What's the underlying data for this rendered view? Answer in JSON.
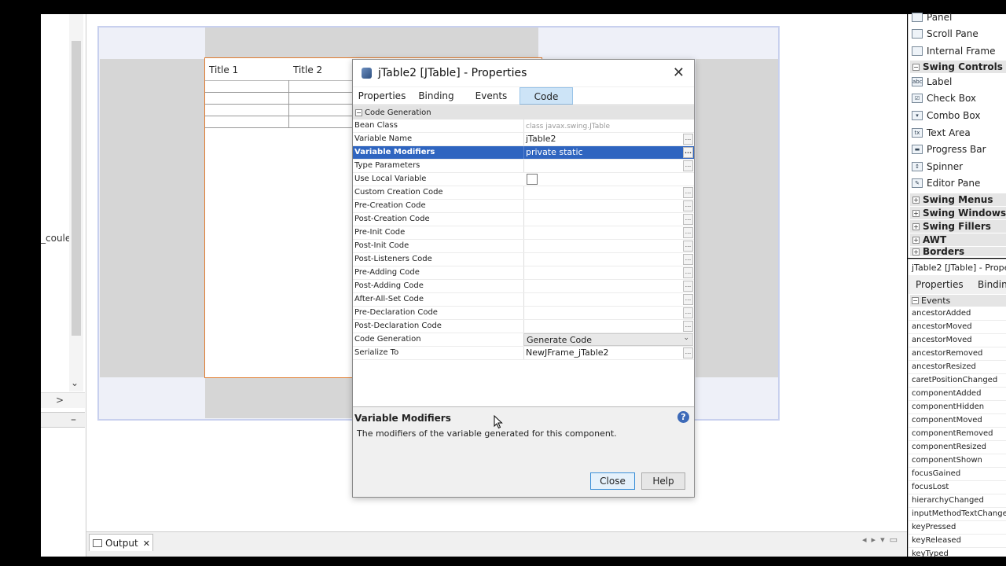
{
  "left_panel": {
    "label": "_couleu"
  },
  "canvas": {
    "table": {
      "col1": "Title 1",
      "col2": "Title 2"
    }
  },
  "output": {
    "tab_label": "Output",
    "close": "✕"
  },
  "palette": {
    "items_top": [
      {
        "label": "Panel",
        "icon": "panel-icon"
      },
      {
        "label": "Scroll Pane",
        "icon": "scroll-pane-icon"
      },
      {
        "label": "Internal Frame",
        "icon": "internal-frame-icon"
      }
    ],
    "swing_controls": "Swing Controls",
    "controls": [
      {
        "label": "Label",
        "icon": "label-icon"
      },
      {
        "label": "Check Box",
        "icon": "check-box-icon"
      },
      {
        "label": "Combo Box",
        "icon": "combo-box-icon"
      },
      {
        "label": "Text Area",
        "icon": "text-area-icon"
      },
      {
        "label": "Progress Bar",
        "icon": "progress-bar-icon"
      },
      {
        "label": "Spinner",
        "icon": "spinner-icon"
      },
      {
        "label": "Editor Pane",
        "icon": "editor-pane-icon"
      }
    ],
    "categories": [
      "Swing Menus",
      "Swing Windows",
      "Swing Fillers",
      "AWT",
      "Borders"
    ]
  },
  "right_props": {
    "title": "jTable2 [JTable] - Prope",
    "tabs": [
      "Properties",
      "Binding"
    ],
    "section": "Events",
    "events": [
      "ancestorAdded",
      "ancestorMoved",
      "ancestorMoved",
      "ancestorRemoved",
      "ancestorResized",
      "caretPositionChanged",
      "componentAdded",
      "componentHidden",
      "componentMoved",
      "componentRemoved",
      "componentResized",
      "componentShown",
      "focusGained",
      "focusLost",
      "hierarchyChanged",
      "inputMethodTextChanged",
      "keyPressed",
      "keyReleased",
      "keyTyped"
    ]
  },
  "dialog": {
    "title": "jTable2 [JTable] - Properties",
    "close": "✕",
    "tabs": [
      "Properties",
      "Binding",
      "Events",
      "Code"
    ],
    "active_tab": "Code",
    "section": "Code Generation",
    "rows": [
      {
        "name": "Bean Class",
        "value": "class javax.swing.JTable"
      },
      {
        "name": "Variable Name",
        "value": "jTable2"
      },
      {
        "name": "Variable Modifiers",
        "value": "private static"
      },
      {
        "name": "Type Parameters",
        "value": ""
      },
      {
        "name": "Use Local Variable",
        "value": ""
      },
      {
        "name": "Custom Creation Code",
        "value": ""
      },
      {
        "name": "Pre-Creation Code",
        "value": ""
      },
      {
        "name": "Post-Creation Code",
        "value": ""
      },
      {
        "name": "Pre-Init Code",
        "value": ""
      },
      {
        "name": "Post-Init Code",
        "value": ""
      },
      {
        "name": "Post-Listeners Code",
        "value": ""
      },
      {
        "name": "Pre-Adding Code",
        "value": ""
      },
      {
        "name": "Post-Adding Code",
        "value": ""
      },
      {
        "name": "After-All-Set Code",
        "value": ""
      },
      {
        "name": "Pre-Declaration Code",
        "value": ""
      },
      {
        "name": "Post-Declaration Code",
        "value": ""
      },
      {
        "name": "Code Generation",
        "value": "Generate Code"
      },
      {
        "name": "Serialize To",
        "value": "NewJFrame_jTable2"
      }
    ],
    "description": {
      "title": "Variable Modifiers",
      "text": "The modifiers of the variable generated for this component."
    },
    "buttons": {
      "close": "Close",
      "help": "Help"
    },
    "colors": {
      "selection": "#2f65c0",
      "active_tab": "#cde4f7"
    }
  }
}
